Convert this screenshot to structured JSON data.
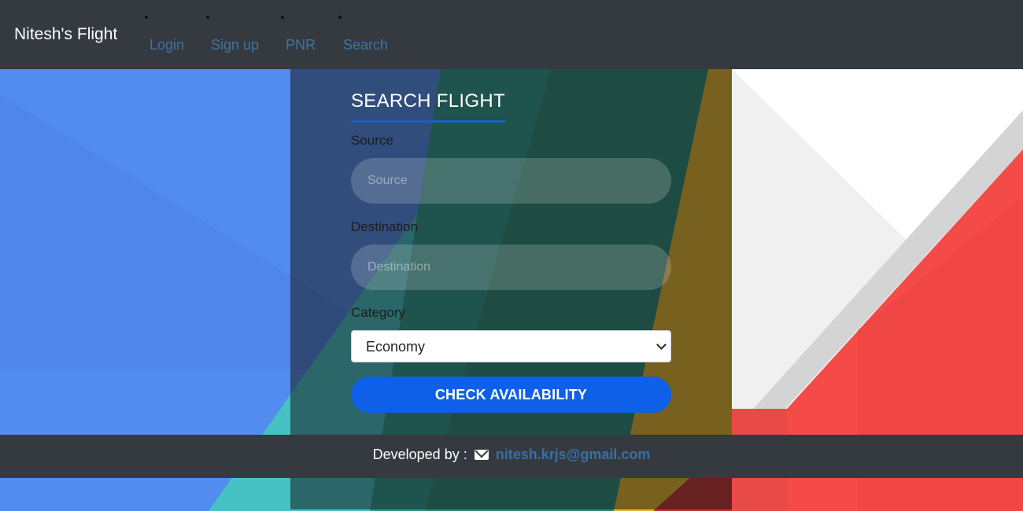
{
  "navbar": {
    "brand": "Nitesh's Flight",
    "links": [
      {
        "label": "Login"
      },
      {
        "label": "Sign up"
      },
      {
        "label": "PNR"
      },
      {
        "label": "Search"
      }
    ]
  },
  "search_form": {
    "title": "SEARCH FLIGHT",
    "source": {
      "label": "Source",
      "placeholder": "Source",
      "value": ""
    },
    "destination": {
      "label": "Destination",
      "placeholder": "Destination",
      "value": ""
    },
    "category": {
      "label": "Category",
      "selected": "Economy"
    },
    "submit_label": "CHECK AVAILABILITY"
  },
  "footer": {
    "prefix": "Developed by :",
    "email": "nitesh.krjs@gmail.com",
    "icon": "envelope-icon"
  },
  "colors": {
    "navbar_bg": "#343a40",
    "link": "#3f73a3",
    "button": "#0d60e7",
    "title_underline": "#1a5ecb",
    "bg_blue": "#4e87ec",
    "bg_red": "#f44a48",
    "bg_teal": "#46c2c4",
    "bg_yellow": "#e6b42c"
  }
}
